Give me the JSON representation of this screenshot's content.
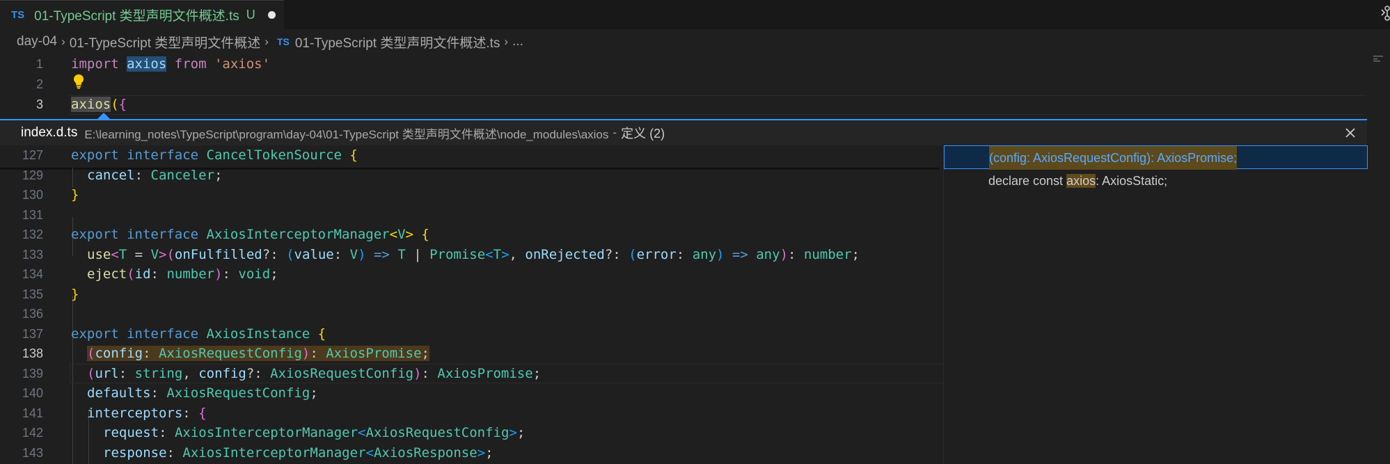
{
  "tab": {
    "lang_badge": "TS",
    "title": "01-TypeScript 类型声明文件概述.ts",
    "status": "U"
  },
  "breadcrumb": {
    "items": [
      "day-04",
      "01-TypeScript 类型声明文件概述",
      "01-TypeScript 类型声明文件概述.ts",
      "..."
    ],
    "lang_badge": "TS"
  },
  "editor": {
    "line_numbers": [
      "1",
      "2",
      "3"
    ],
    "line1": {
      "import": "import",
      "name": "axios",
      "from": "from",
      "module": "'axios'"
    },
    "line3": {
      "call": "axios",
      "paren": "(",
      "brace": "{"
    }
  },
  "peek": {
    "file": "index.d.ts",
    "path": "E:\\learning_notes\\TypeScript\\program\\day-04\\01-TypeScript 类型声明文件概述\\node_modules\\axios",
    "separator": "-",
    "definitions_label": "定义 (2)",
    "line_numbers": [
      "127",
      "129",
      "130",
      "131",
      "132",
      "133",
      "134",
      "135",
      "136",
      "137",
      "138",
      "139",
      "140",
      "141",
      "142",
      "143"
    ],
    "code": {
      "l127": {
        "export": "export",
        "interface": "interface",
        "name": "CancelTokenSource",
        "brace": "{"
      },
      "l129": {
        "prop": "cancel",
        "colon": ":",
        "type": "Canceler",
        "semi": ";"
      },
      "l130": {
        "brace": "}"
      },
      "l132": {
        "export": "export",
        "interface": "interface",
        "name": "AxiosInterceptorManager",
        "lt": "<",
        "tparam": "V",
        "gt": ">",
        "brace": "{"
      },
      "l133": {
        "method": "use",
        "lt": "<",
        "t": "T",
        "eq": " = ",
        "v": "V",
        "gt": ">",
        "paren_open": "(",
        "p1": "onFulfilled",
        "opt1": "?: ",
        "po2": "(",
        "p2": "value",
        "c2": ": ",
        "v2": "V",
        "pc2": ")",
        "arrow": " => ",
        "t2": "T",
        "bar": " | ",
        "promise": "Promise",
        "lt2": "<",
        "t3": "T",
        "gt2": ">",
        "comma": ", ",
        "p3": "onRejected",
        "opt3": "?: ",
        "po3": "(",
        "p4": "error",
        "c4": ": ",
        "any1": "any",
        "pc3": ")",
        "arrow2": " => ",
        "any2": "any",
        "paren_close": ")",
        "c5": ": ",
        "number": "number",
        "semi": ";"
      },
      "l134": {
        "method": "eject",
        "po": "(",
        "p": "id",
        "c": ": ",
        "type": "number",
        "pc": ")",
        "c2": ": ",
        "ret": "void",
        "semi": ";"
      },
      "l135": {
        "brace": "}"
      },
      "l137": {
        "export": "export",
        "interface": "interface",
        "name": "AxiosInstance",
        "brace": "{"
      },
      "l138": {
        "po": "(",
        "p": "config",
        "c": ": ",
        "type": "AxiosRequestConfig",
        "pc": ")",
        "c2": ": ",
        "ret": "AxiosPromise",
        "semi": ";"
      },
      "l139": {
        "po": "(",
        "p1": "url",
        "c1": ": ",
        "t1": "string",
        "comma": ", ",
        "p2": "config",
        "c2": "?: ",
        "t2": "AxiosRequestConfig",
        "pc": ")",
        "c3": ": ",
        "ret": "AxiosPromise",
        "semi": ";"
      },
      "l140": {
        "p": "defaults",
        "c": ": ",
        "t": "AxiosRequestConfig",
        "semi": ";"
      },
      "l141": {
        "p": "interceptors",
        "c": ": ",
        "brace": "{"
      },
      "l142": {
        "p": "request",
        "c": ": ",
        "t": "AxiosInterceptorManager",
        "lt": "<",
        "ta": "AxiosRequestConfig",
        "gt": ">",
        "semi": ";"
      },
      "l143": {
        "p": "response",
        "c": ": ",
        "t": "AxiosInterceptorManager",
        "lt": "<",
        "ta": "AxiosResponse",
        "gt": ">",
        "semi": ";"
      }
    },
    "references": {
      "item1": "(config: AxiosRequestConfig): AxiosPromise;",
      "item2_prefix": "declare const ",
      "item2_hl": "axios",
      "item2_suffix": ": AxiosStatic;"
    }
  }
}
